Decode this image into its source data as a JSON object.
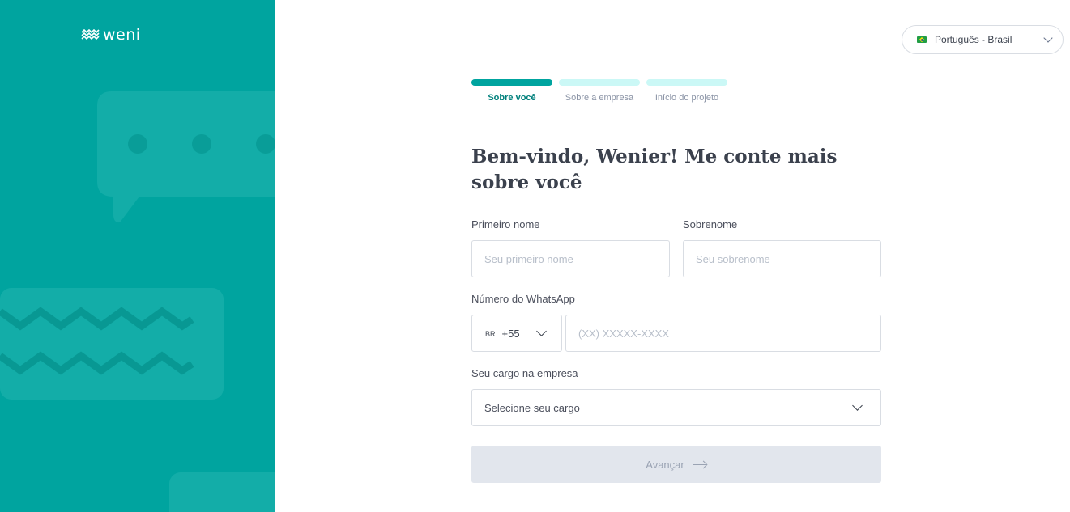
{
  "brand": {
    "logo_text": "weni",
    "panel_color": "#00a49f",
    "logo_icon": "waves-logo-icon"
  },
  "language": {
    "flag_icon": "brazil-flag-icon",
    "selected": "Português - Brasil"
  },
  "steps": [
    {
      "label": "Sobre você",
      "active": true
    },
    {
      "label": "Sobre a empresa",
      "active": false
    },
    {
      "label": "Início do projeto",
      "active": false
    }
  ],
  "heading": "Bem-vindo, Wenier! Me conte mais sobre você",
  "form": {
    "first_name": {
      "label": "Primeiro nome",
      "placeholder": "Seu primeiro nome",
      "value": ""
    },
    "last_name": {
      "label": "Sobrenome",
      "placeholder": "Seu sobrenome",
      "value": ""
    },
    "whatsapp": {
      "label": "Número do WhatsApp",
      "country_code": "BR",
      "dial_code": "+55",
      "placeholder": "(XX) XXXXX-XXXX",
      "value": ""
    },
    "role": {
      "label": "Seu cargo na empresa",
      "selected": "Selecione seu cargo"
    },
    "submit_label": "Avançar",
    "submit_enabled": false
  },
  "colors": {
    "accent": "#00a49f",
    "step_inactive": "#cbf8f6",
    "button_disabled": "#e2e6ed"
  }
}
